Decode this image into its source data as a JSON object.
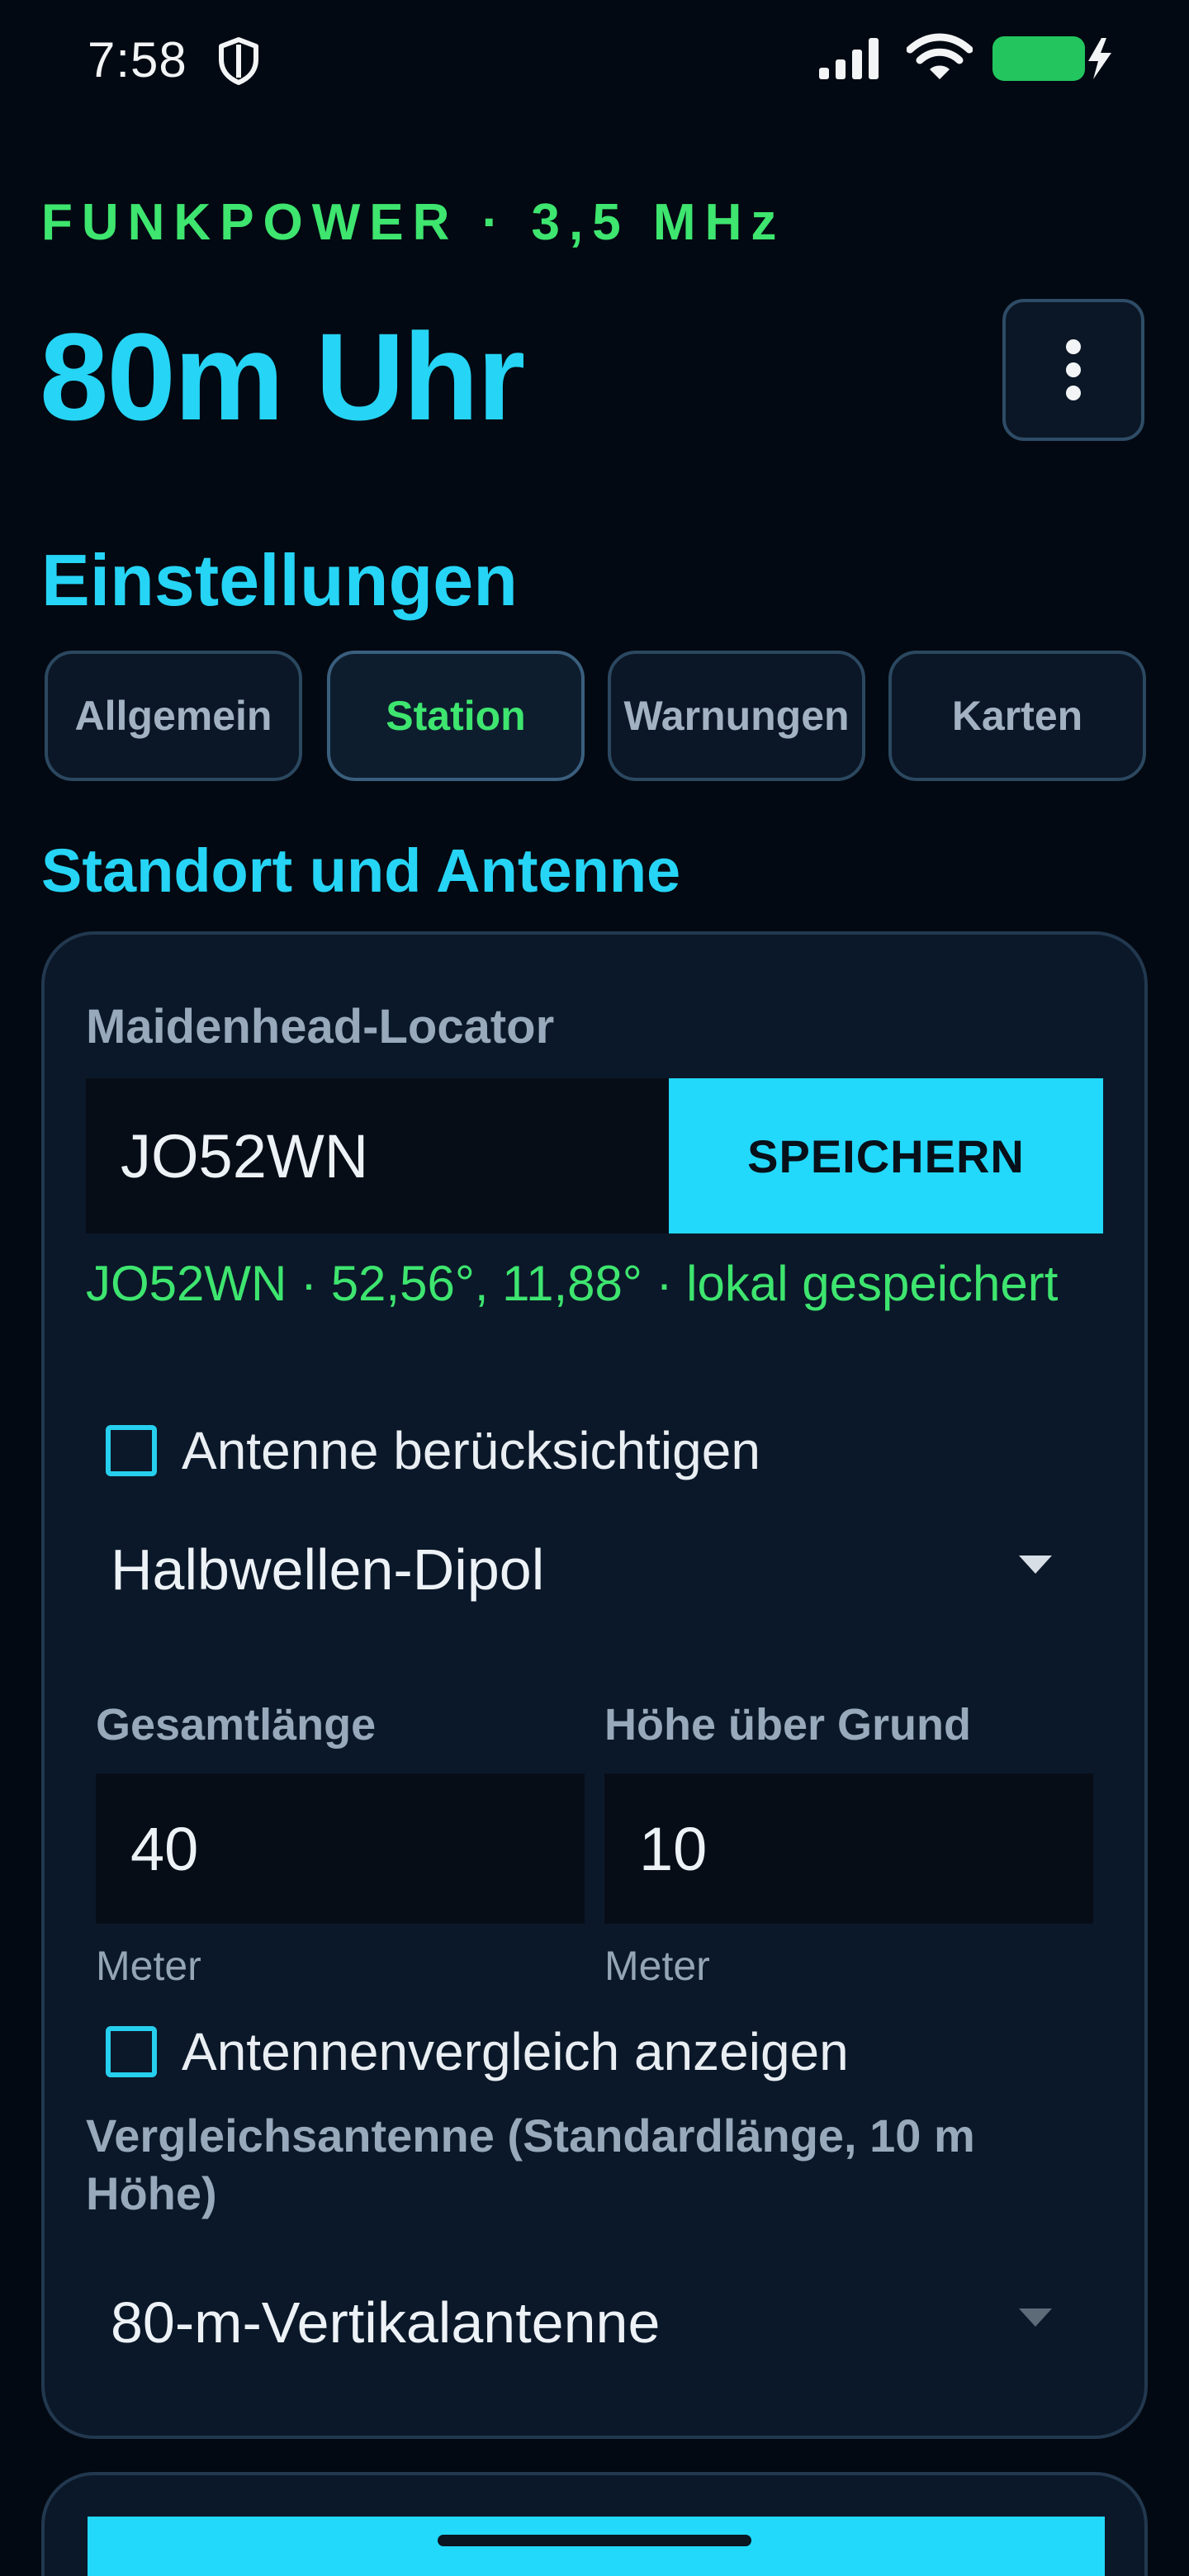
{
  "status_bar": {
    "time": "7:58",
    "icons": [
      "shield-icon",
      "signal-icon",
      "wifi-icon",
      "battery-icon"
    ],
    "battery_color": "#22c55e"
  },
  "header": {
    "brand": "FUNKPOWER · 3,5 MHz",
    "title": "80m Uhr",
    "menu_icon": "kebab-icon"
  },
  "settings": {
    "title": "Einstellungen",
    "tabs": [
      {
        "label": "Allgemein",
        "active": false
      },
      {
        "label": "Station",
        "active": true
      },
      {
        "label": "Warnungen",
        "active": false
      },
      {
        "label": "Karten",
        "active": false
      }
    ]
  },
  "station": {
    "section_title": "Standort und Antenne",
    "locator": {
      "label": "Maidenhead-Locator",
      "value": "JO52WN",
      "save_label": "SPEICHERN",
      "status": "JO52WN · 52,56°, 11,88° · lokal gespeichert"
    },
    "antenna": {
      "checkbox_label": "Antenne berücksichtigen",
      "checked": false,
      "type": "Halbwellen-Dipol",
      "length_label": "Gesamtlänge",
      "length_value": "40",
      "length_unit": "Meter",
      "height_label": "Höhe über Grund",
      "height_value": "10",
      "height_unit": "Meter"
    },
    "comparison": {
      "checkbox_label": "Antennenvergleich anzeigen",
      "checked": false,
      "select_label": "Vergleichsantenne (Standardlänge, 10 m Höhe)",
      "select_value": "80-m-Vertikalantenne"
    }
  },
  "colors": {
    "accent_cyan": "#22d9fc",
    "accent_green": "#3ee56f",
    "background": "#030912",
    "card": "#0b1829"
  }
}
